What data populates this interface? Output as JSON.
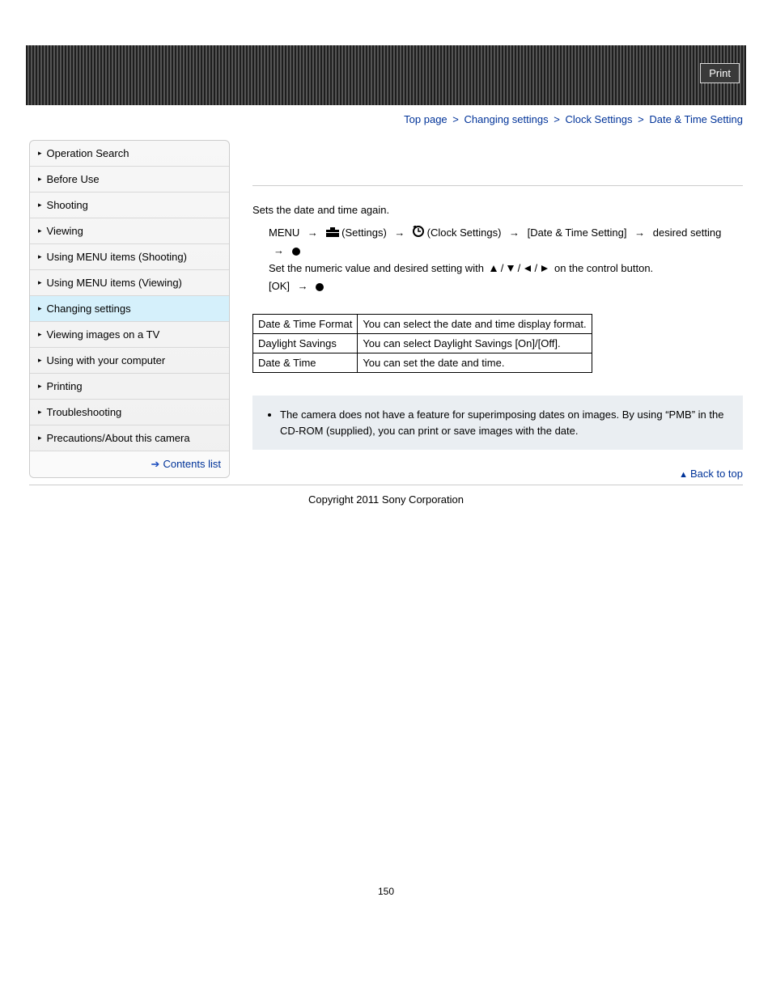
{
  "header": {
    "print": "Print"
  },
  "breadcrumb": {
    "items": [
      "Top page",
      "Changing settings",
      "Clock Settings",
      "Date & Time Setting"
    ],
    "sep": ">"
  },
  "sidebar": {
    "items": [
      {
        "label": "Operation Search"
      },
      {
        "label": "Before Use"
      },
      {
        "label": "Shooting"
      },
      {
        "label": "Viewing"
      },
      {
        "label": "Using MENU items (Shooting)"
      },
      {
        "label": "Using MENU items (Viewing)"
      },
      {
        "label": "Changing settings",
        "active": true
      },
      {
        "label": "Viewing images on a TV"
      },
      {
        "label": "Using with your computer"
      },
      {
        "label": "Printing"
      },
      {
        "label": "Troubleshooting"
      },
      {
        "label": "Precautions/About this camera"
      }
    ],
    "contents": "Contents list"
  },
  "content": {
    "intro": "Sets the date and time again.",
    "step_menu": "MENU",
    "step_settings": "(Settings)",
    "step_clock": "(Clock Settings)",
    "step_date": "[Date & Time Setting]",
    "step_desired": "desired setting",
    "step_numeric": "Set the numeric value and desired setting with",
    "step_control": "on the control button.",
    "step_ok": "[OK]",
    "slash": "/"
  },
  "table": {
    "rows": [
      {
        "k": "Date & Time Format",
        "v": "You can select the date and time display format."
      },
      {
        "k": "Daylight Savings",
        "v": "You can select Daylight Savings [On]/[Off]."
      },
      {
        "k": "Date & Time",
        "v": "You can set the date and time."
      }
    ]
  },
  "note": {
    "items": [
      "The camera does not have a feature for superimposing dates on images. By using “PMB” in the CD-ROM (supplied), you can print or save images with the date."
    ]
  },
  "footer": {
    "backtop": "Back to top",
    "copyright": "Copyright 2011 Sony Corporation",
    "page": "150"
  }
}
